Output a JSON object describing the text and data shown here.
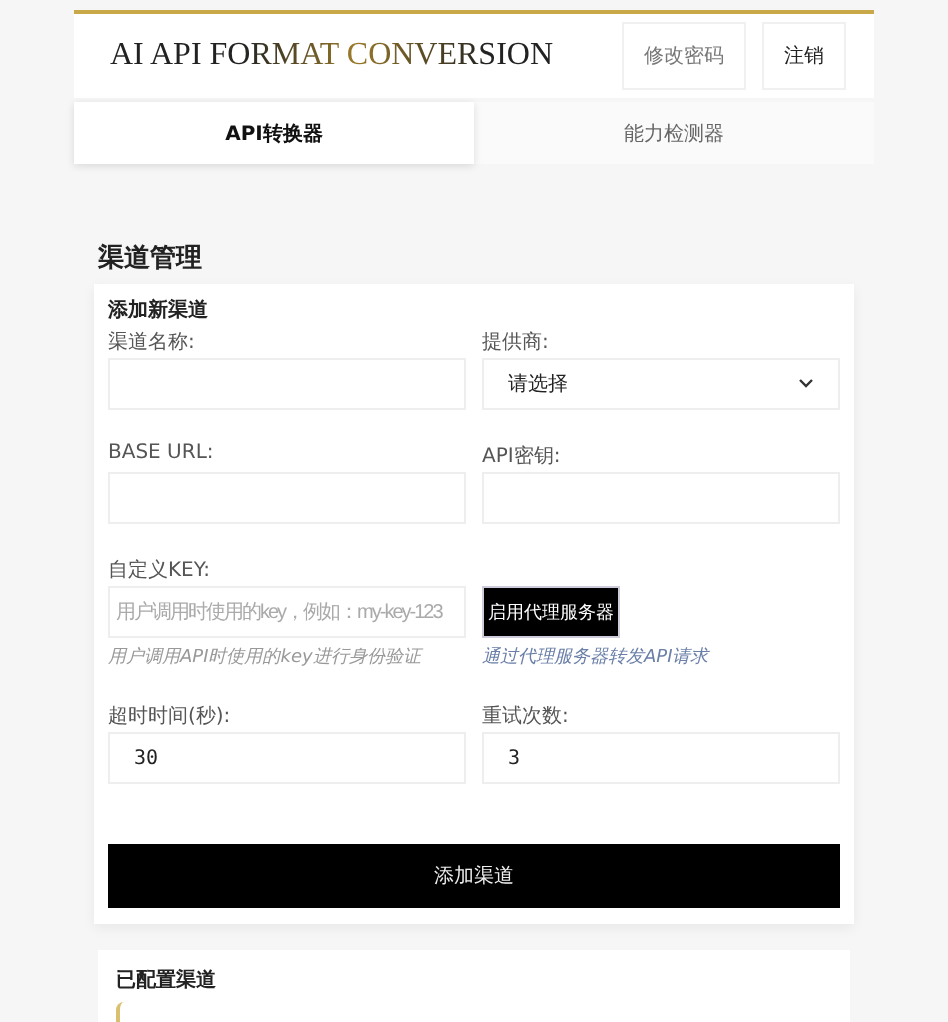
{
  "header": {
    "title": "AI API FORMAT CONVERSION",
    "buttons": [
      "修改密码",
      "注销"
    ]
  },
  "tabs": [
    {
      "label": "API转换器",
      "selected": true
    },
    {
      "label": "能力检测器",
      "selected": false
    }
  ],
  "section_title": "渠道管理",
  "add_form": {
    "title": "添加新渠道",
    "fields": [
      {
        "kind": "text",
        "label": "渠道名称:"
      },
      {
        "kind": "select",
        "label": "提供商:",
        "value": "请选择"
      },
      {
        "kind": "text",
        "label": "BASE URL:"
      },
      {
        "kind": "password",
        "label": "API密钥:"
      },
      {
        "kind": "text",
        "label": "自定义KEY:",
        "placeholder": "用户调用时使用的key，例如：my-key-123",
        "hint": "用户调用API时使用的key进行身份验证"
      },
      {
        "kind": "toggle",
        "label": "启用代理服务器",
        "hint": "通过代理服务器转发API请求",
        "on": false
      },
      {
        "kind": "text",
        "label": "超时时间(秒):",
        "value": "30"
      },
      {
        "kind": "text",
        "label": "重试次数:",
        "value": "3"
      }
    ],
    "submit": "添加渠道"
  },
  "configured": {
    "title": "已配置渠道"
  }
}
